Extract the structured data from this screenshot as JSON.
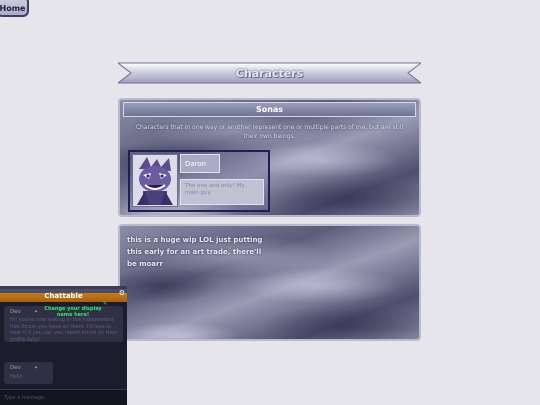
{
  "nav": {
    "home_label": "Home"
  },
  "page": {
    "title": "Characters"
  },
  "sonas": {
    "header": "Sonas",
    "description": "Characters that in one way or another represent one or multiple parts of me, but are still their own beings.",
    "character": {
      "name": "Daron",
      "description": "The one and only! My main guy."
    }
  },
  "notes": {
    "text": "this is a huge wip LOL just putting this early for an art trade, there'll be moarr"
  },
  "chat": {
    "title": "Chattable",
    "gear_icon": "gear-icon",
    "tooltip": "Change your display name here!",
    "messages": [
      {
        "author": "Dev",
        "text": "Hi! you're now talking in the independent free forum you have an them. I'd love to hear it if you can you report errors on their profile fully!"
      },
      {
        "author": "Dev",
        "text": "Hello"
      }
    ],
    "input_placeholder": "Type a message..."
  }
}
